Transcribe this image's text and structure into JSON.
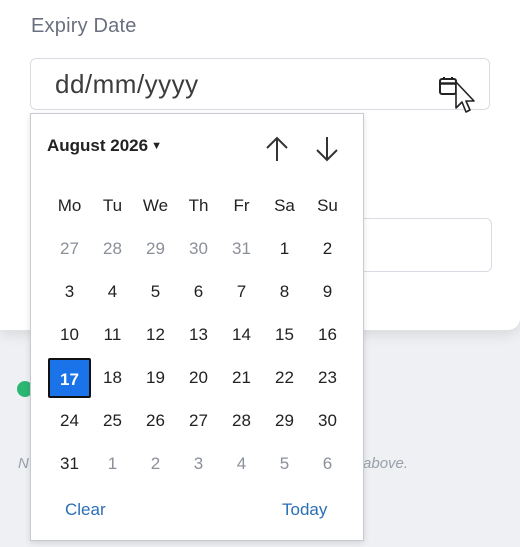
{
  "form": {
    "field_label": "Expiry Date",
    "date_value": "dd/mm/yyyy",
    "hint_left": "N",
    "hint_right": "om above."
  },
  "calendar": {
    "month_label": "August 2026",
    "weekdays": [
      "Mo",
      "Tu",
      "We",
      "Th",
      "Fr",
      "Sa",
      "Su"
    ],
    "weeks": [
      [
        {
          "d": "27",
          "o": true
        },
        {
          "d": "28",
          "o": true
        },
        {
          "d": "29",
          "o": true
        },
        {
          "d": "30",
          "o": true
        },
        {
          "d": "31",
          "o": true
        },
        {
          "d": "1"
        },
        {
          "d": "2"
        }
      ],
      [
        {
          "d": "3"
        },
        {
          "d": "4"
        },
        {
          "d": "5"
        },
        {
          "d": "6"
        },
        {
          "d": "7"
        },
        {
          "d": "8"
        },
        {
          "d": "9"
        }
      ],
      [
        {
          "d": "10"
        },
        {
          "d": "11"
        },
        {
          "d": "12"
        },
        {
          "d": "13"
        },
        {
          "d": "14"
        },
        {
          "d": "15"
        },
        {
          "d": "16"
        }
      ],
      [
        {
          "d": "17",
          "s": true
        },
        {
          "d": "18"
        },
        {
          "d": "19"
        },
        {
          "d": "20"
        },
        {
          "d": "21"
        },
        {
          "d": "22"
        },
        {
          "d": "23"
        }
      ],
      [
        {
          "d": "24"
        },
        {
          "d": "25"
        },
        {
          "d": "26"
        },
        {
          "d": "27"
        },
        {
          "d": "28"
        },
        {
          "d": "29"
        },
        {
          "d": "30"
        }
      ],
      [
        {
          "d": "31"
        },
        {
          "d": "1",
          "o": true
        },
        {
          "d": "2",
          "o": true
        },
        {
          "d": "3",
          "o": true
        },
        {
          "d": "4",
          "o": true
        },
        {
          "d": "5",
          "o": true
        },
        {
          "d": "6",
          "o": true
        }
      ]
    ],
    "clear_label": "Clear",
    "today_label": "Today"
  },
  "icons": {
    "calendar": "calendar-icon",
    "prev": "arrow-up-icon",
    "next": "arrow-down-icon",
    "caret": "caret-down-icon",
    "cursor": "mouse-cursor-icon",
    "status": "check-circle-icon"
  },
  "colors": {
    "accent": "#1a73e8",
    "link": "#2a6fb5",
    "status_green": "#2bb673"
  }
}
